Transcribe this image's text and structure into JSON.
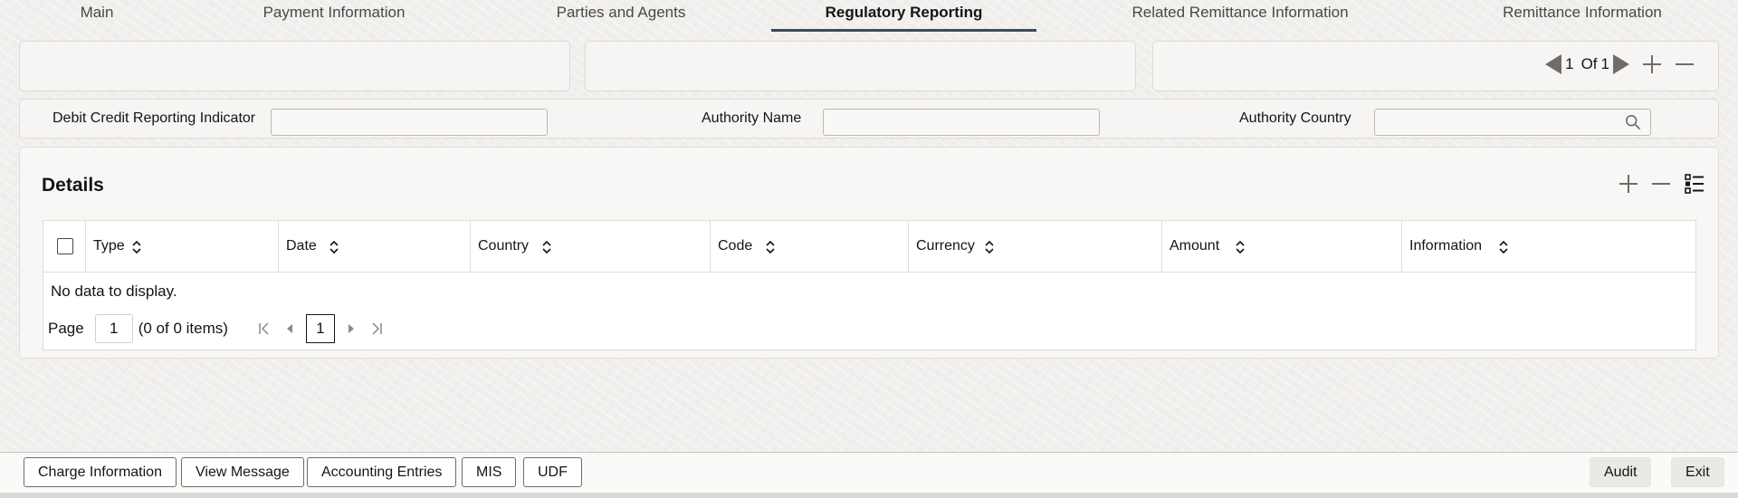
{
  "tabs": [
    {
      "label": "Main",
      "active": false
    },
    {
      "label": "Payment Information",
      "active": false
    },
    {
      "label": "Parties and Agents",
      "active": false
    },
    {
      "label": "Regulatory Reporting",
      "active": true
    },
    {
      "label": "Related Remittance Information",
      "active": false
    },
    {
      "label": "Remittance Information",
      "active": false
    }
  ],
  "pager": {
    "current": "1",
    "of_label": "Of",
    "total": "1"
  },
  "fields": {
    "debit_credit_label": "Debit Credit Reporting Indicator",
    "debit_credit_value": "",
    "authority_name_label": "Authority Name",
    "authority_name_value": "",
    "authority_country_label": "Authority Country",
    "authority_country_value": ""
  },
  "details": {
    "title": "Details",
    "columns": [
      "Type",
      "Date",
      "Country",
      "Code",
      "Currency",
      "Amount",
      "Information"
    ],
    "empty_text": "No data to display.",
    "page_label": "Page",
    "page_value": "1",
    "items_text": "(0 of 0 items)",
    "current_page": "1"
  },
  "footer": {
    "charge_information": "Charge Information",
    "view_message": "View Message",
    "accounting_entries": "Accounting Entries",
    "mis": "MIS",
    "udf": "UDF",
    "audit": "Audit",
    "exit": "Exit"
  },
  "colors": {
    "accent": "#3b4a5e",
    "background": "#f1efed",
    "icon": "#6f6c69"
  }
}
